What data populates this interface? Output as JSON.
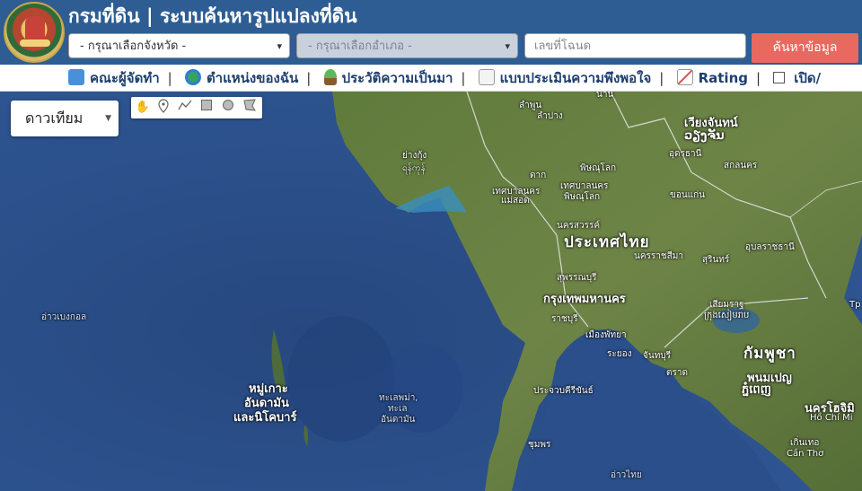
{
  "header": {
    "title": "กรมที่ดิน | ระบบค้นหารูปแปลงที่ดิน",
    "province_select": "- กรุณาเลือกจังหวัด -",
    "amphoe_select": "- กรุณาเลือกอำเภอ -",
    "deed_placeholder": "เลขที่โฉนด",
    "search_button": "ค้นหาข้อมูล"
  },
  "nav": {
    "items": [
      {
        "label": "คณะผู้จัดทำ",
        "icon": "people-icon"
      },
      {
        "label": "ตำแหน่งของฉัน",
        "icon": "globe-icon"
      },
      {
        "label": "ประวัติความเป็นมา",
        "icon": "sprout-icon"
      },
      {
        "label": "แบบประเมินความพึงพอใจ",
        "icon": "memo-icon"
      },
      {
        "label": "Rating",
        "icon": "chart-icon"
      }
    ],
    "separator": "|",
    "toggle_label": "เปิด/"
  },
  "map": {
    "layer_select": "ดาวเทียม",
    "tools": [
      "hand-icon",
      "marker-icon",
      "polyline-icon",
      "rectangle-icon",
      "circle-icon",
      "polygon-icon"
    ],
    "labels": {
      "nan": "น่าน",
      "lamphun": "ลำพูน",
      "lampang": "ลำปาง",
      "vientiane_th": "เวียงจันทน์",
      "vientiane_lo": "ວຽງຈັນ",
      "udon": "อุดรธานี",
      "sakon": "สกลนคร",
      "yangon1": "ย่างกุ้ง",
      "yangon2": "ရန်ကုန်",
      "tak": "ตาก",
      "phitsanulok": "พิษณุโลก",
      "phitsanulok_city": "เทศบาลนคร",
      "phitsanulok_city2": "พิษณุโลก",
      "maesot1": "เทศบาลนคร",
      "maesot2": "แม่สอด",
      "khonkaen": "ขอนแก่น",
      "nakhonsawan": "นครสวรรค์",
      "thailand": "ประเทศไทย",
      "korat": "นครราชสีมา",
      "surin": "สุรินทร์",
      "ubon": "อุบลราชธานี",
      "suphan": "สุพรรณบุรี",
      "bangkok": "กรุงเทพมหานคร",
      "ratchaburi": "ราชบุรี",
      "pattaya": "เมืองพัทยา",
      "rayong": "ระยอง",
      "chanthaburi": "จันทบุรี",
      "trat": "ตราด",
      "siemreap1": "เสียมราฐ",
      "siemreap2": "ក្រុងសៀមរាប",
      "cambodia": "กัมพูชา",
      "phnompenh1": "พนมเปญ",
      "phnompenh2": "ភ្នំពេញ",
      "hcm1": "นครโฮจิมิ",
      "hcm2": "Hồ Chí Mi",
      "cantho1": "เกิ่นเทอ",
      "cantho2": "Cần Thơ",
      "prachuap": "ประจวบคีรีขันธ์",
      "chumphon": "ชุมพร",
      "bengal": "อ่าวเบงกอล",
      "andaman1": "หมู่เกาะ",
      "andaman2": "อันดามัน",
      "andaman3": "และนิโคบาร์",
      "andamansea1": "ทะเลพม่า,",
      "andamansea2": "ทะเล",
      "andamansea3": "อันดามัน",
      "gulf": "อ่าวไทย",
      "tp": "Tp"
    }
  }
}
